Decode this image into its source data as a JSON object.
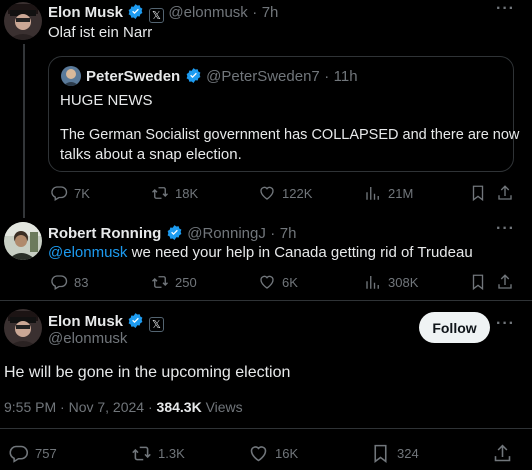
{
  "tweet1": {
    "name": "Elon Musk",
    "handle": "@elonmusk",
    "dot": "·",
    "time": "7h",
    "text": "Olaf ist ein Narr",
    "quote": {
      "name": "PeterSweden",
      "handle": "@PeterSweden7",
      "dot": "·",
      "time": "11h",
      "line1": "HUGE NEWS",
      "line2": "The German Socialist government has COLLAPSED and there are now",
      "line3": "talks about a snap election."
    },
    "actions": {
      "replies": "7K",
      "retweets": "18K",
      "likes": "122K",
      "views": "21M"
    }
  },
  "tweet2": {
    "name": "Robert Ronning",
    "handle": "@RonningJ",
    "dot": "·",
    "time": "7h",
    "mention": "@elonmusk",
    "text": " we need your help in Canada getting rid of Trudeau",
    "actions": {
      "replies": "83",
      "retweets": "250",
      "likes": "6K",
      "views": "308K"
    }
  },
  "main": {
    "name": "Elon Musk",
    "handle": "@elonmusk",
    "follow_label": "Follow",
    "text": "He will be gone in the upcoming election",
    "timestamp": "9:55 PM · Nov 7, 2024",
    "dot": "·",
    "views_count": "384.3K",
    "views_label": "Views",
    "actions": {
      "replies": "757",
      "retweets": "1.3K",
      "likes": "16K",
      "bookmarks": "324"
    }
  },
  "icons": {
    "verified_color": "#1d9bf0",
    "affiliate_glyph": "𝕏",
    "more": "···"
  }
}
